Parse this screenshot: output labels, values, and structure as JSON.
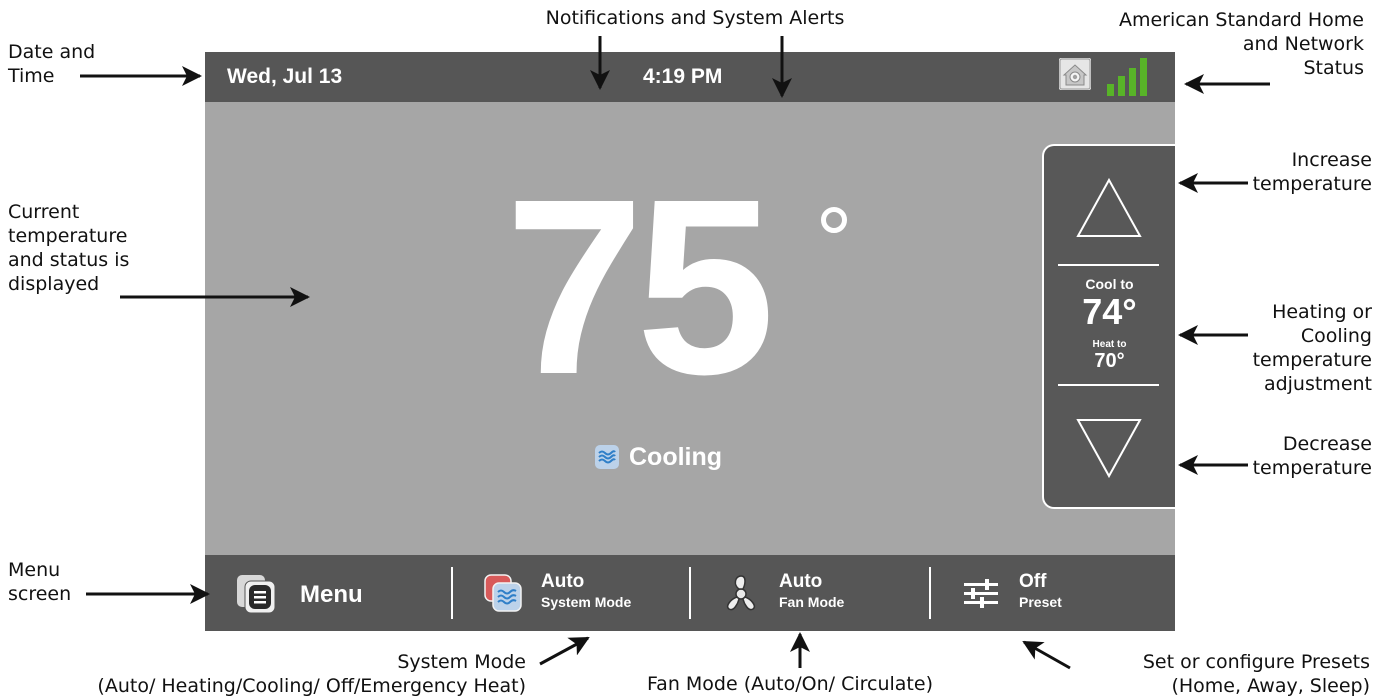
{
  "annotations": {
    "notifications": "Notifications and System Alerts",
    "network_status": [
      "American Standard Home",
      "and Network",
      "Status"
    ],
    "date_time": [
      "Date and",
      "Time"
    ],
    "current_temp": [
      "Current",
      "temperature",
      "and status is",
      "displayed"
    ],
    "increase": [
      "Increase",
      "temperature"
    ],
    "adjustment": [
      "Heating or",
      "Cooling",
      "temperature",
      "adjustment"
    ],
    "decrease": [
      "Decrease",
      "temperature"
    ],
    "menu": [
      "Menu",
      "screen"
    ],
    "system_mode": [
      "System Mode",
      "(Auto/ Heating/Cooling/ Off/Emergency Heat)"
    ],
    "fan_mode": "Fan Mode (Auto/On/ Circulate)",
    "presets": [
      "Set or configure Presets",
      "(Home, Away, Sleep)"
    ]
  },
  "topbar": {
    "date": "Wed, Jul 13",
    "time": "4:19 PM",
    "signal_color": "#58b428",
    "signal_bars": 4
  },
  "main": {
    "current_temp": "75",
    "status": "Cooling"
  },
  "setpoint_panel": {
    "cool_label": "Cool to",
    "cool_value": "74°",
    "heat_label": "Heat to",
    "heat_value": "70°"
  },
  "bottombar": {
    "menu_label": "Menu",
    "system_mode": {
      "value": "Auto",
      "label": "System Mode"
    },
    "fan_mode": {
      "value": "Auto",
      "label": "Fan Mode"
    },
    "preset": {
      "value": "Off",
      "label": "Preset"
    }
  },
  "colors": {
    "screen_bg": "#a6a6a6",
    "bar_bg": "#565656",
    "panel_bg": "#585858",
    "accent_blue": "#2f7fc8"
  },
  "icons": [
    "home-icon",
    "signal-icon",
    "cooling-icon",
    "up-arrow-icon",
    "down-arrow-icon",
    "menu-icon",
    "system-mode-icon",
    "fan-icon",
    "preset-sliders-icon"
  ]
}
